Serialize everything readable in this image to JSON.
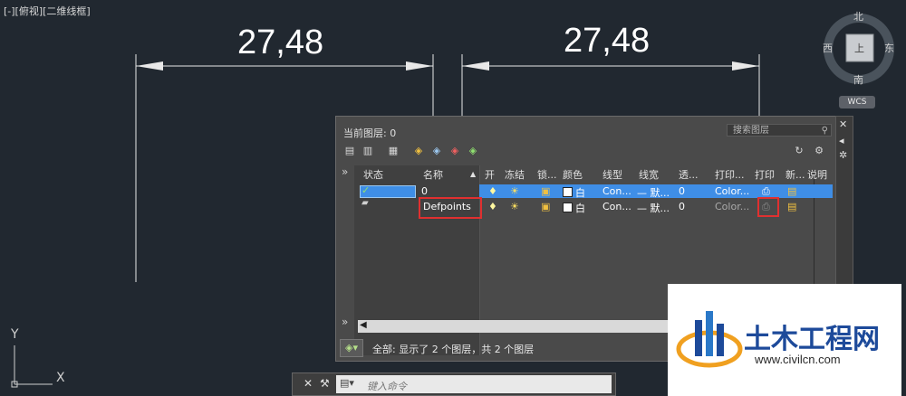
{
  "viewport": {
    "label": "[-][俯视][二维线框]"
  },
  "dimensions": {
    "left_value": "27,48",
    "right_value": "27,48"
  },
  "viewcube": {
    "north": "北",
    "south": "南",
    "west": "西",
    "east": "东",
    "face": "上",
    "wcs": "WCS"
  },
  "layer_panel": {
    "current_layer": "当前图层: 0",
    "search_placeholder": "搜索图层",
    "columns": [
      "状态",
      "名称",
      "开",
      "冻结",
      "锁...",
      "颜色",
      "线型",
      "线宽",
      "透...",
      "打印...",
      "打印",
      "新...",
      "说明"
    ],
    "rows": [
      {
        "name": "0",
        "color": "白",
        "linetype": "Con...",
        "lineweight": "— 默...",
        "transparency": "0",
        "plot_style": "Color..."
      },
      {
        "name": "Defpoints",
        "color": "白",
        "linetype": "Con...",
        "lineweight": "— 默...",
        "transparency": "0",
        "plot_style": "Color..."
      }
    ],
    "status": "全部: 显示了 2 个图层，共 2 个图层"
  },
  "ucs": {
    "x": "X",
    "y": "Y"
  },
  "command_line": {
    "placeholder": "键入命令"
  },
  "watermark": {
    "title": "土木工程网",
    "url": "www.civilcn.com"
  }
}
